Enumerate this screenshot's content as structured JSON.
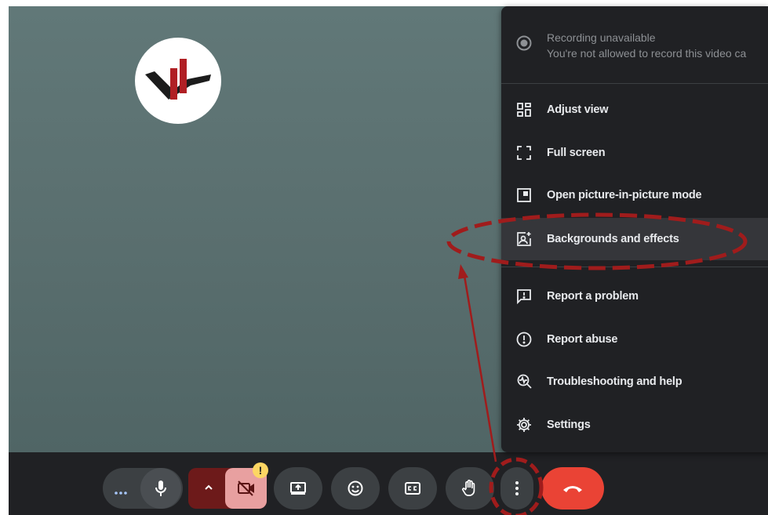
{
  "menu": {
    "recording": {
      "title": "Recording unavailable",
      "subtitle": "You're not allowed to record this video ca"
    },
    "items": [
      {
        "label": "Adjust view",
        "icon": "adjust-view-icon"
      },
      {
        "label": "Full screen",
        "icon": "fullscreen-icon"
      },
      {
        "label": "Open picture-in-picture mode",
        "icon": "picture-in-picture-icon"
      },
      {
        "label": "Backgrounds and effects",
        "icon": "backgrounds-effects-icon"
      },
      {
        "label": "Report a problem",
        "icon": "report-problem-icon"
      },
      {
        "label": "Report abuse",
        "icon": "report-abuse-icon"
      },
      {
        "label": "Troubleshooting and help",
        "icon": "troubleshooting-icon"
      },
      {
        "label": "Settings",
        "icon": "settings-icon"
      }
    ]
  },
  "toolbar": {
    "buttons": [
      "more-dots-icon",
      "microphone-icon",
      "chevron-up-icon",
      "camera-off-icon",
      "present-screen-icon",
      "emoji-icon",
      "captions-icon",
      "raise-hand-icon",
      "more-options-icon",
      "end-call-icon"
    ],
    "warning_badge": "!"
  },
  "colors": {
    "stage": "#5a6f6f",
    "menu_bg": "#202124",
    "camera_off_bg": "#e8a0a0",
    "end_call": "#ea4335",
    "annotation": "#a01c1c",
    "badge": "#fdd663"
  }
}
